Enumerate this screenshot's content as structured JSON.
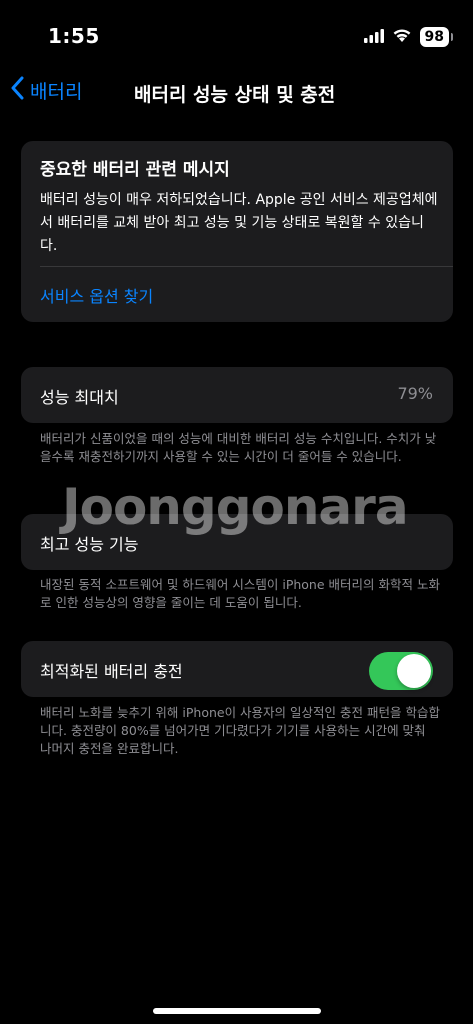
{
  "status_bar": {
    "time": "1:55",
    "battery_level": "98",
    "icons": [
      "signal-icon",
      "wifi-icon",
      "battery-icon"
    ]
  },
  "nav": {
    "back_label": "배터리",
    "title": "배터리 성능 상태 및 충전"
  },
  "message": {
    "title": "중요한 배터리 관련 메시지",
    "body": "배터리 성능이 매우 저하되었습니다. Apple 공인 서비스 제공업체에서 배터리를 교체 받아 최고 성능 및 기능 상태로 복원할 수 있습니다.",
    "link": "서비스 옵션 찾기"
  },
  "max_capacity": {
    "label": "성능 최대치",
    "value": "79%",
    "footnote": "배터리가 신품이었을 때의 성능에 대비한 배터리 성능 수치입니다. 수치가 낮을수록 재충전하기까지 사용할 수 있는 시간이 더 줄어들 수 있습니다."
  },
  "peak_performance": {
    "label": "최고 성능 기능",
    "footnote": "내장된 동적 소프트웨어 및 하드웨어 시스템이 iPhone 배터리의 화학적 노화로 인한 성능상의 영향을 줄이는 데 도움이 됩니다."
  },
  "optimized_charging": {
    "label": "최적화된 배터리 충전",
    "enabled": true,
    "footnote": "배터리 노화를 늦추기 위해 iPhone이 사용자의 일상적인 충전 패턴을 학습합니다. 충전량이 80%를 넘어가면 기다렸다가 기기를 사용하는 시간에 맞춰 나머지 충전을 완료합니다."
  },
  "watermark": "Joonggonara",
  "colors": {
    "accent": "#0a84ff",
    "toggle_on": "#34c759",
    "card_bg": "#1c1c1e",
    "secondary_text": "#8e8e93"
  }
}
